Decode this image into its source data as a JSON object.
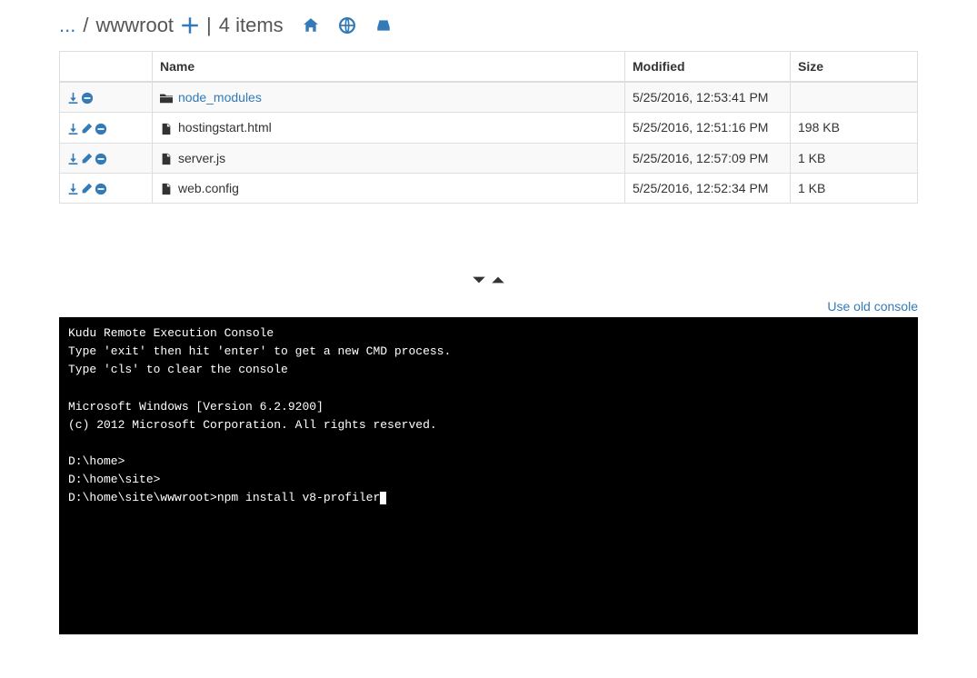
{
  "breadcrumb": {
    "ellipsis": "...",
    "sep": "/",
    "current": "wwwroot",
    "bar": "|",
    "count": "4 items"
  },
  "table": {
    "headers": {
      "name": "Name",
      "modified": "Modified",
      "size": "Size"
    }
  },
  "rows": [
    {
      "type": "folder",
      "name": "node_modules",
      "modified": "5/25/2016, 12:53:41 PM",
      "size": ""
    },
    {
      "type": "file",
      "name": "hostingstart.html",
      "modified": "5/25/2016, 12:51:16 PM",
      "size": "198 KB"
    },
    {
      "type": "file",
      "name": "server.js",
      "modified": "5/25/2016, 12:57:09 PM",
      "size": "1 KB"
    },
    {
      "type": "file",
      "name": "web.config",
      "modified": "5/25/2016, 12:52:34 PM",
      "size": "1 KB"
    }
  ],
  "links": {
    "old_console": "Use old console"
  },
  "terminal": {
    "lines": [
      "Kudu Remote Execution Console",
      "Type 'exit' then hit 'enter' to get a new CMD process.",
      "Type 'cls' to clear the console",
      "",
      "Microsoft Windows [Version 6.2.9200]",
      "(c) 2012 Microsoft Corporation. All rights reserved.",
      "",
      "D:\\home>",
      "D:\\home\\site>"
    ],
    "prompt": "D:\\home\\site\\wwwroot>",
    "input": "npm install v8-profiler"
  }
}
